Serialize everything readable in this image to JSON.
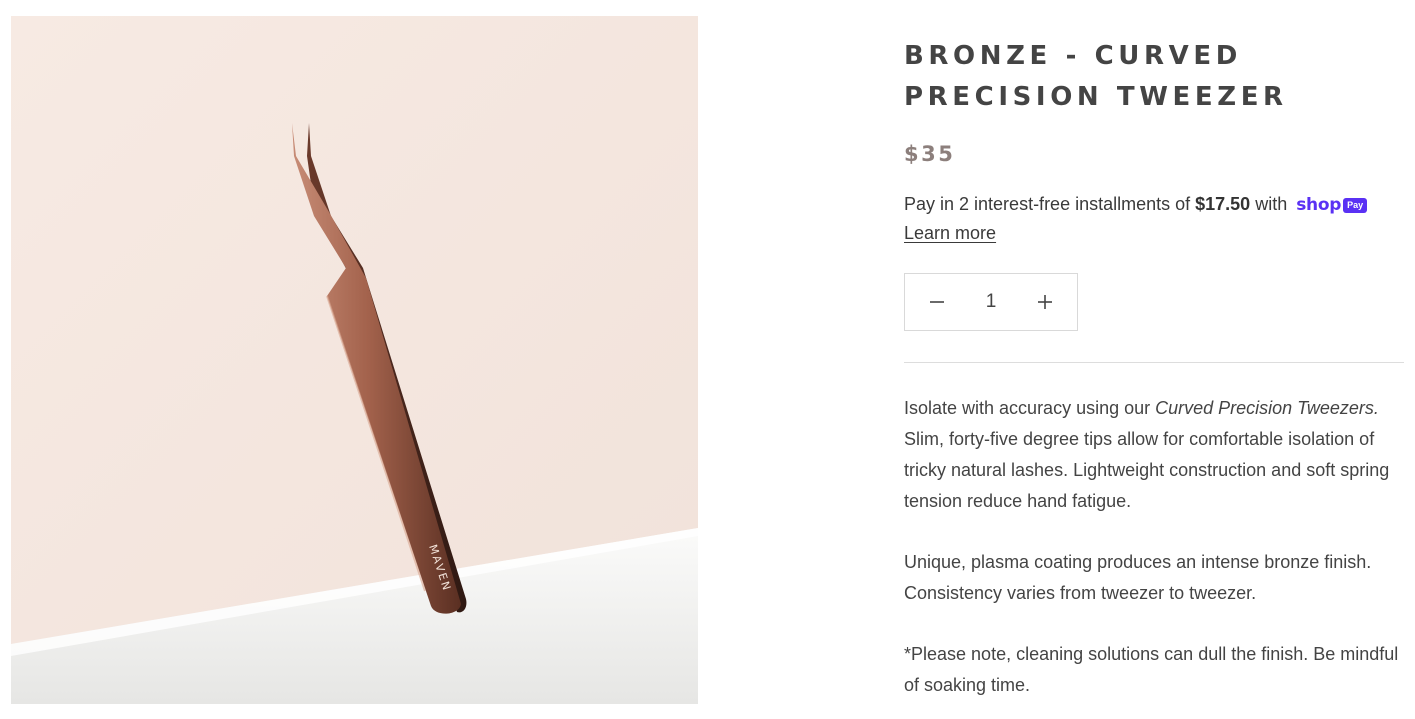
{
  "product": {
    "title_line1": "BRONZE - CURVED",
    "title_line2": "PRECISION TWEEZER",
    "price": "$35",
    "image_brand_mark": "MAVEN"
  },
  "installments": {
    "prefix": "Pay in 2 interest-free installments of ",
    "amount": "$17.50",
    "suffix": " with",
    "shop_word": "shop",
    "pay_word": "Pay",
    "learn_more": "Learn more"
  },
  "quantity": {
    "value": "1",
    "decrease_icon": "minus-icon",
    "increase_icon": "plus-icon"
  },
  "description": {
    "p1_before": "Isolate with accuracy using our ",
    "p1_em": "Curved Precision Tweezers.",
    "p1_after": " Slim, forty-five degree tips allow for comfortable isolation of tricky natural lashes. Lightweight construction and soft spring tension reduce hand fatigue.",
    "p2": "Unique, plasma coating produces an intense bronze finish. Consistency varies from tweezer to tweezer.",
    "p3": "*Please note, cleaning solutions can dull the finish. Be mindful of soaking time."
  },
  "colors": {
    "shop_pay_purple": "#5a31f4",
    "price_gray": "#8c7f7c",
    "background_blush": "#f5e8e1",
    "tweezer_bronze": "#9a5c48"
  }
}
